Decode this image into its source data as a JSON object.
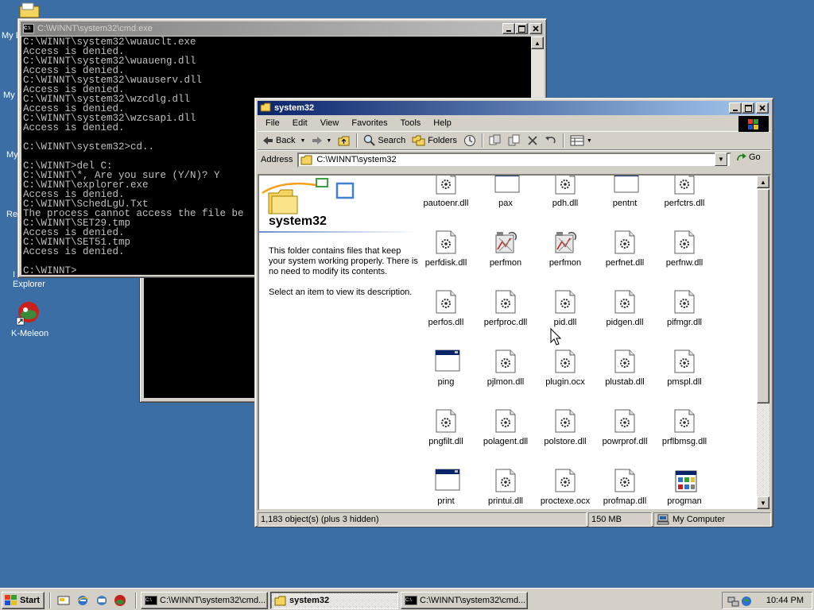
{
  "desktop": {
    "icons": [
      {
        "label": "My D",
        "icon": "my-documents-icon"
      },
      {
        "label": "My",
        "icon": "my-computer-icon"
      },
      {
        "label": "My",
        "icon": "my-network-places-icon"
      },
      {
        "label": "Re",
        "icon": "recycle-bin-icon"
      },
      {
        "label": "Explorer",
        "prefix": "I",
        "icon": "internet-explorer-icon"
      },
      {
        "label": "K-Meleon",
        "icon": "k-meleon-icon"
      }
    ]
  },
  "cmd": {
    "title": "C:\\WINNT\\system32\\cmd.exe",
    "lines": [
      "C:\\WINNT\\system32\\wuauclt.exe",
      "Access is denied.",
      "C:\\WINNT\\system32\\wuaueng.dll",
      "Access is denied.",
      "C:\\WINNT\\system32\\wuauserv.dll",
      "Access is denied.",
      "C:\\WINNT\\system32\\wzcdlg.dll",
      "Access is denied.",
      "C:\\WINNT\\system32\\wzcsapi.dll",
      "Access is denied.",
      "",
      "C:\\WINNT\\system32>cd..",
      "",
      "C:\\WINNT>del C:",
      "C:\\WINNT\\*, Are you sure (Y/N)? Y",
      "C:\\WINNT\\explorer.exe",
      "Access is denied.",
      "C:\\WINNT\\SchedLgU.Txt",
      "The process cannot access the file be",
      "C:\\WINNT\\SET29.tmp",
      "Access is denied.",
      "C:\\WINNT\\SET51.tmp",
      "Access is denied.",
      "",
      "C:\\WINNT>"
    ]
  },
  "explorer": {
    "title": "system32",
    "menu": [
      "File",
      "Edit",
      "View",
      "Favorites",
      "Tools",
      "Help"
    ],
    "toolbar": {
      "back": "Back",
      "search": "Search",
      "folders": "Folders"
    },
    "address_label": "Address",
    "address_value": "C:\\WINNT\\system32",
    "go_label": "Go",
    "panel": {
      "heading": "system32",
      "description": "This folder contains files that keep your system working properly. There is no need to modify its contents.",
      "hint": "Select an item to view its description."
    },
    "files": [
      {
        "name": "pautoenr.dll",
        "type": "dll"
      },
      {
        "name": "pax",
        "type": "exe"
      },
      {
        "name": "pdh.dll",
        "type": "dll"
      },
      {
        "name": "pentnt",
        "type": "exe"
      },
      {
        "name": "perfctrs.dll",
        "type": "dll"
      },
      {
        "name": "perfdisk.dll",
        "type": "dll"
      },
      {
        "name": "perfmon",
        "type": "perfmon"
      },
      {
        "name": "perfmon",
        "type": "perfmon"
      },
      {
        "name": "perfnet.dll",
        "type": "dll"
      },
      {
        "name": "perfnw.dll",
        "type": "dll"
      },
      {
        "name": "perfos.dll",
        "type": "dll"
      },
      {
        "name": "perfproc.dll",
        "type": "dll"
      },
      {
        "name": "pid.dll",
        "type": "dll"
      },
      {
        "name": "pidgen.dll",
        "type": "dll"
      },
      {
        "name": "pifmgr.dll",
        "type": "dll"
      },
      {
        "name": "ping",
        "type": "exe"
      },
      {
        "name": "pjlmon.dll",
        "type": "dll"
      },
      {
        "name": "plugin.ocx",
        "type": "dll"
      },
      {
        "name": "plustab.dll",
        "type": "dll"
      },
      {
        "name": "pmspl.dll",
        "type": "dll"
      },
      {
        "name": "pngfilt.dll",
        "type": "dll"
      },
      {
        "name": "polagent.dll",
        "type": "dll"
      },
      {
        "name": "polstore.dll",
        "type": "dll"
      },
      {
        "name": "powrprof.dll",
        "type": "dll"
      },
      {
        "name": "prflbmsg.dll",
        "type": "dll"
      },
      {
        "name": "print",
        "type": "exe"
      },
      {
        "name": "printui.dll",
        "type": "dll"
      },
      {
        "name": "proctexe.ocx",
        "type": "dll"
      },
      {
        "name": "profmap.dll",
        "type": "dll"
      },
      {
        "name": "progman",
        "type": "progman"
      }
    ],
    "status": {
      "objects": "1,183 object(s) (plus 3 hidden)",
      "size": "150 MB",
      "zone": "My Computer"
    }
  },
  "taskbar": {
    "start": "Start",
    "tasks": [
      {
        "label": "C:\\WINNT\\system32\\cmd...",
        "icon": "cmd-icon",
        "pressed": false
      },
      {
        "label": "system32",
        "icon": "folder-icon",
        "pressed": true
      },
      {
        "label": "C:\\WINNT\\system32\\cmd...",
        "icon": "cmd-icon",
        "pressed": false
      }
    ],
    "clock": "10:44 PM"
  },
  "colors": {
    "desktop": "#3a6ea5",
    "active_title": "#0a246a",
    "inactive_title": "#808080"
  }
}
